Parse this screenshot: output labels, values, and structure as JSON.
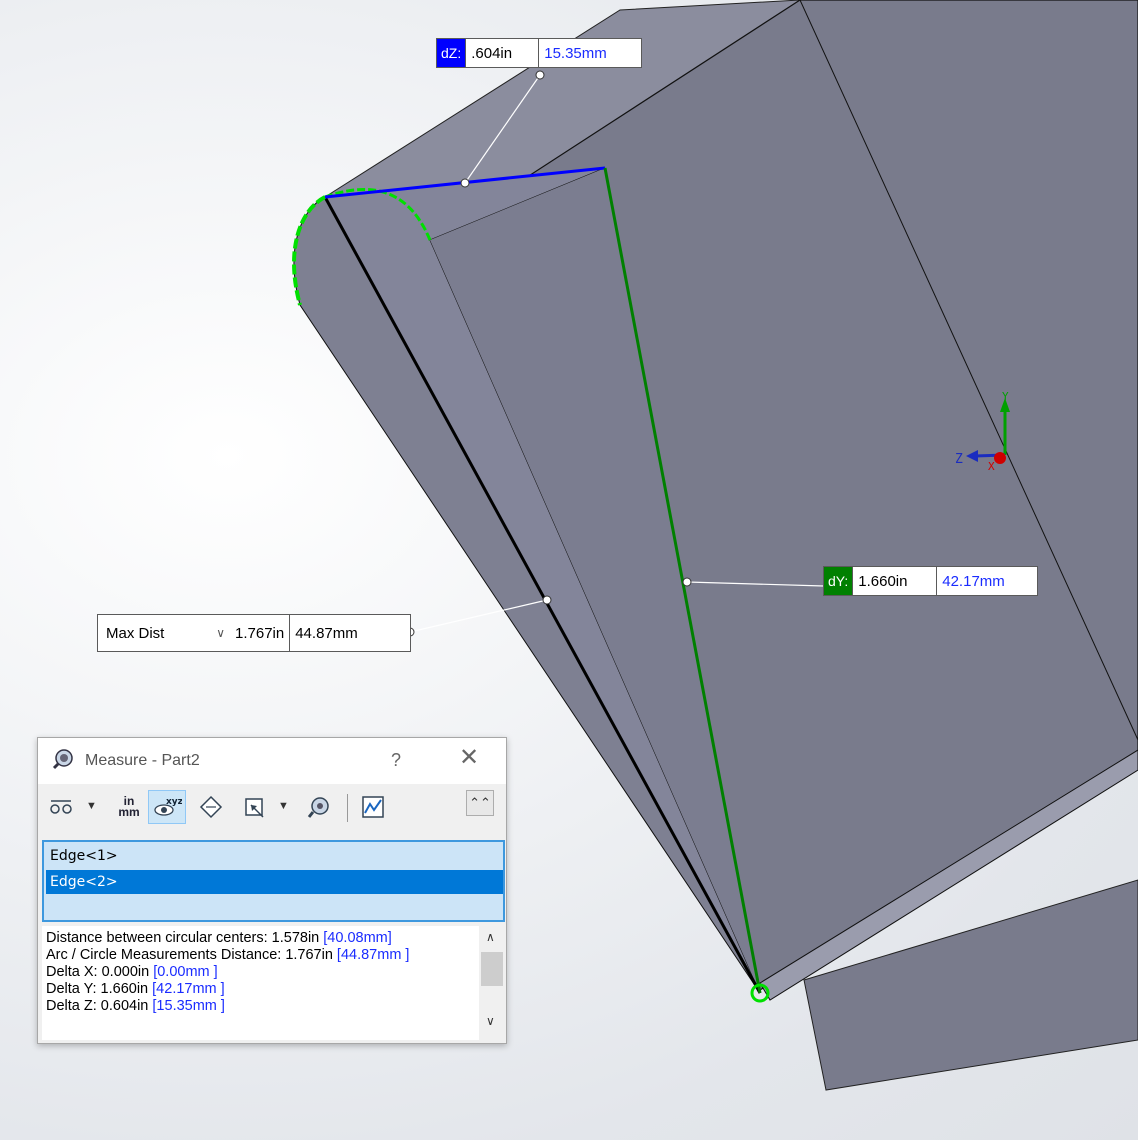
{
  "callouts": {
    "dz": {
      "tag": "dZ:",
      "inch": ".604in",
      "mm": "15.35mm",
      "color": "#0000ff"
    },
    "dy": {
      "tag": "dY:",
      "inch": "1.660in",
      "mm": "42.17mm",
      "color": "#008000"
    },
    "maxdist": {
      "mode": "Max Dist",
      "inch": "1.767in",
      "mm": "44.87mm"
    }
  },
  "triad": {
    "z_label": "Z",
    "y_label": "Y",
    "x_label": "X"
  },
  "dialog": {
    "title": "Measure - Part2",
    "help": "?",
    "close": "✕",
    "toolbar": {
      "arc_circle": "arc-circle-options",
      "units_in": "in",
      "units_mm": "mm",
      "xyz_label": "xyz",
      "collapse": "⌃⌃"
    },
    "selections": [
      "Edge<1>",
      "Edge<2>"
    ],
    "results": {
      "line1_text": "Distance between circular centers: 1.578in ",
      "line1_mm": "[40.08mm]",
      "line2_text": "Arc / Circle Measurements Distance: 1.767in ",
      "line2_mm": "[44.87mm ]",
      "line3_text": "Delta X: 0.000in  ",
      "line3_mm": "[0.00mm ]",
      "line4_text": "Delta Y: 1.660in  ",
      "line4_mm": "[42.17mm ]",
      "line5_text": "Delta Z: 0.604in  ",
      "line5_mm": "[15.35mm ]"
    }
  },
  "colors": {
    "part_face": "#797b8c",
    "part_face_light": "#8a8c9c",
    "accent_blue": "#0000ff",
    "accent_green": "#00c000",
    "selection_blue": "#0078d7"
  }
}
